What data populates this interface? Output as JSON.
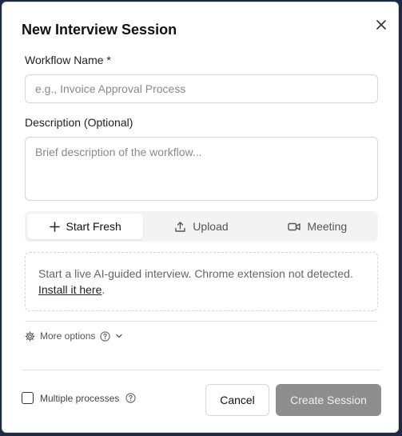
{
  "dialog": {
    "title": "New Interview Session",
    "close_icon": "close-icon"
  },
  "workflow_name": {
    "label": "Workflow Name *",
    "value": "",
    "placeholder": "e.g., Invoice Approval Process"
  },
  "description": {
    "label": "Description (Optional)",
    "value": "",
    "placeholder": "Brief description of the workflow..."
  },
  "tabs": [
    {
      "label": "Start Fresh",
      "icon": "plus-icon",
      "active": true
    },
    {
      "label": "Upload",
      "icon": "upload-icon",
      "active": false
    },
    {
      "label": "Meeting",
      "icon": "video-icon",
      "active": false
    }
  ],
  "info": {
    "text": "Start a live AI-guided interview. Chrome extension not detected. ",
    "link_text": "Install it here",
    "suffix": "."
  },
  "more_options": {
    "label": "More options",
    "icons": [
      "gear-icon",
      "help-icon",
      "chevron-down-icon"
    ]
  },
  "multiple_processes": {
    "label": "Multiple processes",
    "checked": false
  },
  "buttons": {
    "cancel": "Cancel",
    "create": "Create Session"
  },
  "colors": {
    "create_button_bg": "#8e8e8e",
    "background": "#1d2a44"
  }
}
